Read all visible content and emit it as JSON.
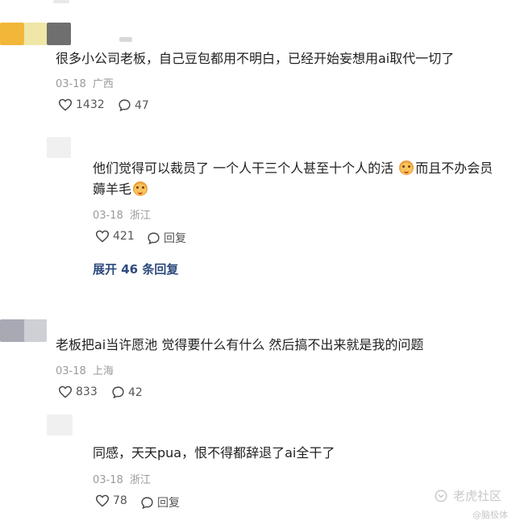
{
  "comments": [
    {
      "text": "很多小公司老板，自己豆包都用不明白，已经开始妄想用ai取代一切了",
      "date": "03-18",
      "location": "广西",
      "likes": "1432",
      "replies": "47"
    },
    {
      "text_part1": "他们觉得可以裁员了 一个人干三个人甚至十个人的活 ",
      "text_part2": "而且不办会员",
      "text_line2": "薅羊毛",
      "date": "03-18",
      "location": "浙江",
      "likes": "421",
      "reply_label": "回复",
      "expand_label": "展开 46 条回复"
    },
    {
      "text": "老板把ai当许愿池 觉得要什么有什么 然后搞不出来就是我的问题",
      "date": "03-18",
      "location": "上海",
      "likes": "833",
      "replies": "42"
    },
    {
      "text": "同感，天天pua，恨不得都辞退了ai全干了",
      "date": "03-18",
      "location": "浙江",
      "likes": "78",
      "reply_label": "回复"
    }
  ],
  "watermark": {
    "brand": "老虎社区",
    "sub": "@脑极体"
  },
  "colors": {
    "accent_link": "#2d4a7c",
    "meta_gray": "#9a9a9a"
  }
}
